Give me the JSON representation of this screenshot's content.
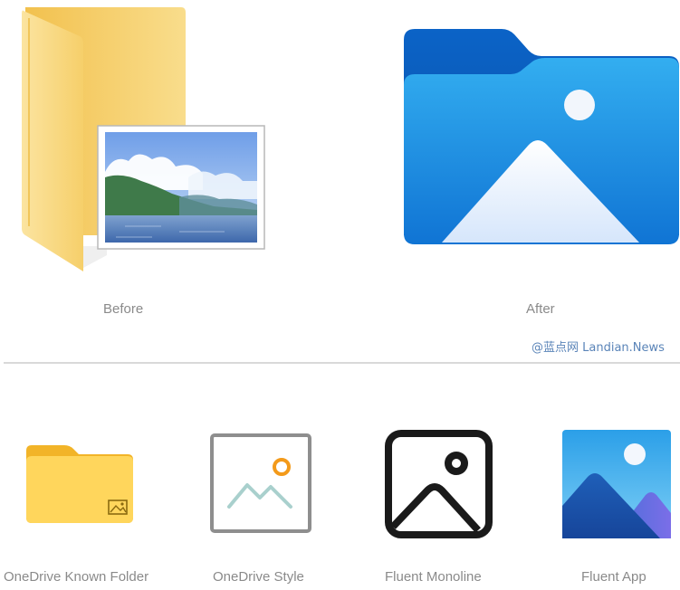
{
  "top": {
    "before_label": "Before",
    "after_label": "After",
    "watermark": "@蓝点网 Landian.News"
  },
  "bottom": {
    "items": [
      {
        "label": "OneDrive Known Folder",
        "icon": "onedrive-known-folder-icon"
      },
      {
        "label": "OneDrive Style",
        "icon": "onedrive-style-picture-icon"
      },
      {
        "label": "Fluent Monoline",
        "icon": "fluent-monoline-picture-icon"
      },
      {
        "label": "Fluent App",
        "icon": "fluent-app-picture-icon"
      }
    ]
  },
  "colors": {
    "old_folder_yellow": "#f7d67c",
    "new_folder_blue": "#1e8fe0",
    "label_gray": "#8a8a8a",
    "watermark_blue": "#5a84b8"
  }
}
